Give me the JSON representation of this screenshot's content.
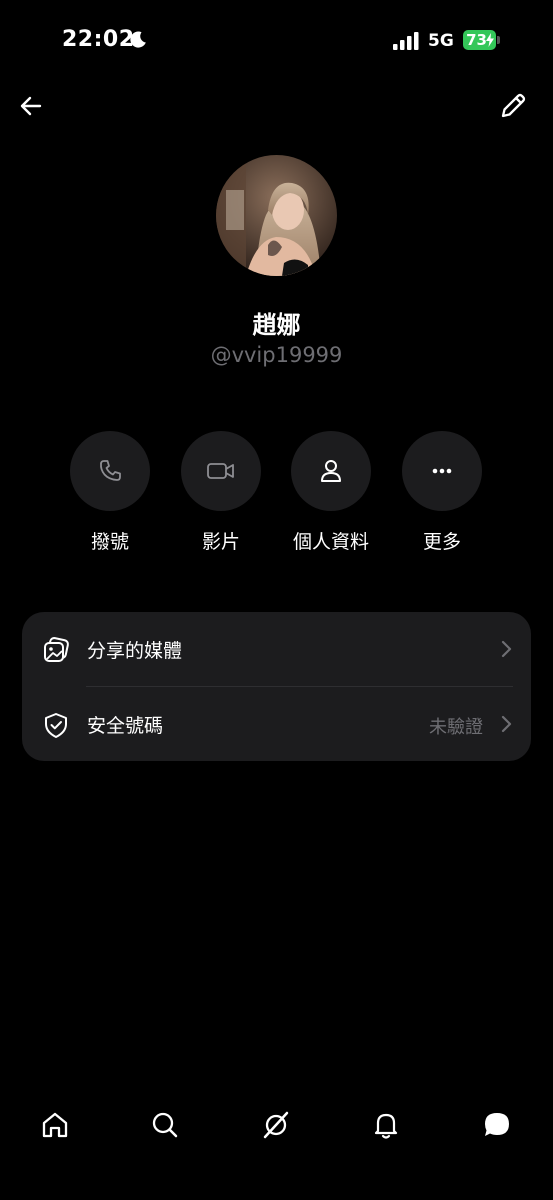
{
  "status_bar": {
    "time": "22:02",
    "network": "5G",
    "battery": "73",
    "icons": [
      "moon-icon",
      "signal-icon",
      "battery-icon"
    ],
    "battery_color": "#34c759"
  },
  "nav": {
    "back_icon": "arrow-left-icon",
    "edit_icon": "pencil-icon"
  },
  "profile": {
    "name": "趙娜",
    "handle": "@vvip19999"
  },
  "actions": [
    {
      "label": "撥號",
      "icon": "phone-icon"
    },
    {
      "label": "影片",
      "icon": "video-icon"
    },
    {
      "label": "個人資料",
      "icon": "person-icon"
    },
    {
      "label": "更多",
      "icon": "more-icon"
    }
  ],
  "list": [
    {
      "label": "分享的媒體",
      "value": "",
      "icon": "media-icon"
    },
    {
      "label": "安全號碼",
      "value": "未驗證",
      "icon": "shield-icon"
    }
  ],
  "tabs": [
    {
      "name": "home",
      "icon": "home-icon"
    },
    {
      "name": "search",
      "icon": "search-icon"
    },
    {
      "name": "grok",
      "icon": "grok-icon"
    },
    {
      "name": "notifications",
      "icon": "bell-icon"
    },
    {
      "name": "messages",
      "icon": "chat-icon"
    }
  ],
  "colors": {
    "background": "#000000",
    "surface": "#1c1c1e",
    "secondary_text": "#6e6e73"
  }
}
